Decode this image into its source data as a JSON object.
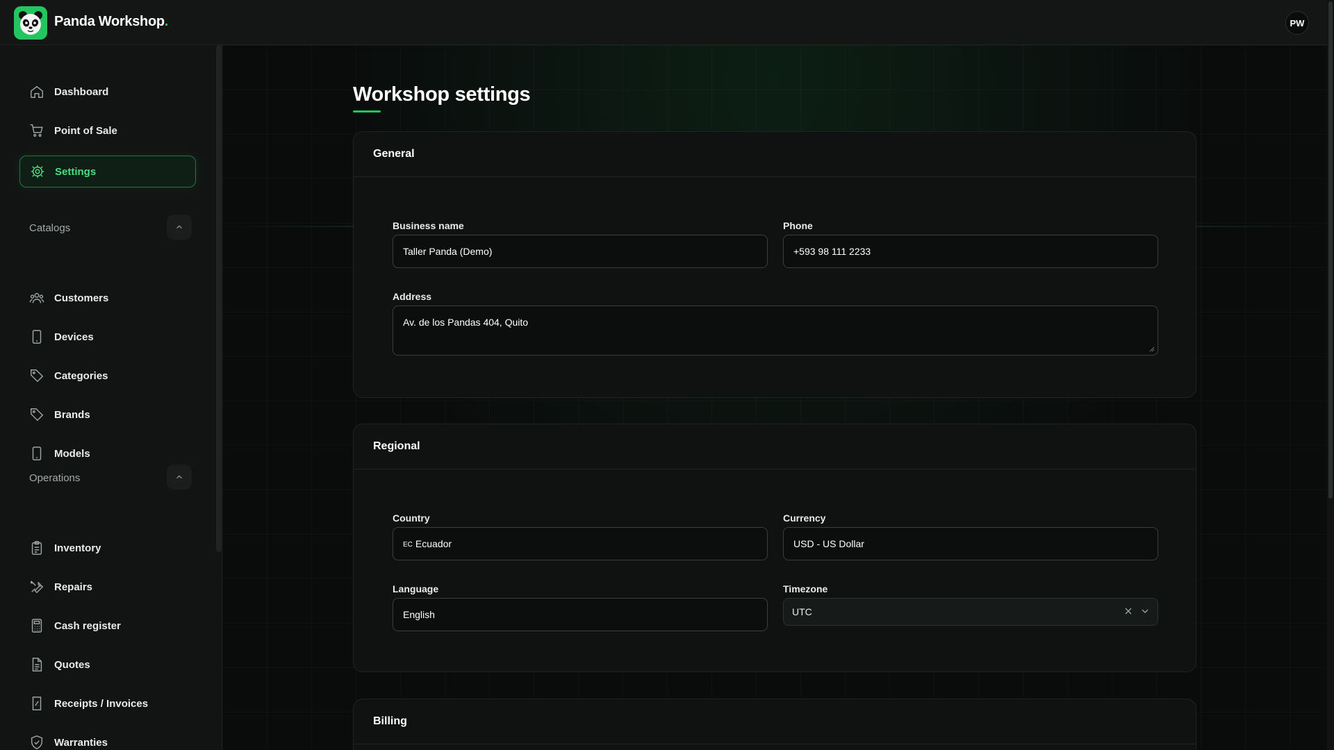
{
  "app": {
    "brand_name": "Panda Workshop",
    "brand_dot": ".",
    "user_initials": "PW",
    "accent_color": "#22c55e"
  },
  "sidebar": {
    "items": [
      {
        "label": "Dashboard",
        "icon": "home-icon"
      },
      {
        "label": "Point of Sale",
        "icon": "cart-icon"
      },
      {
        "label": "Settings",
        "icon": "gear-icon",
        "active": true
      }
    ],
    "catalogs": {
      "label": "Catalogs",
      "items": [
        {
          "label": "Customers",
          "icon": "users-icon"
        },
        {
          "label": "Devices",
          "icon": "phone-icon"
        },
        {
          "label": "Categories",
          "icon": "tag-icon"
        },
        {
          "label": "Brands",
          "icon": "tag-icon"
        },
        {
          "label": "Models",
          "icon": "phone-icon"
        }
      ]
    },
    "operations": {
      "label": "Operations",
      "items": [
        {
          "label": "Inventory",
          "icon": "clipboard-icon"
        },
        {
          "label": "Repairs",
          "icon": "tools-icon"
        },
        {
          "label": "Cash register",
          "icon": "calculator-icon"
        },
        {
          "label": "Quotes",
          "icon": "document-icon"
        },
        {
          "label": "Receipts / Invoices",
          "icon": "receipt-icon"
        },
        {
          "label": "Warranties",
          "icon": "shield-icon"
        }
      ]
    }
  },
  "main": {
    "title": "Workshop settings",
    "general": {
      "heading": "General",
      "business_name_label": "Business name",
      "business_name_value": "Taller Panda (Demo)",
      "phone_label": "Phone",
      "phone_value": "+593 98 111 2233",
      "address_label": "Address",
      "address_value": "Av. de los Pandas 404, Quito"
    },
    "regional": {
      "heading": "Regional",
      "country_label": "Country",
      "country_code": "EC",
      "country_value": "Ecuador",
      "currency_label": "Currency",
      "currency_value": "USD - US Dollar",
      "language_label": "Language",
      "language_value": "English",
      "timezone_label": "Timezone",
      "timezone_value": "UTC"
    },
    "billing": {
      "heading": "Billing"
    }
  }
}
